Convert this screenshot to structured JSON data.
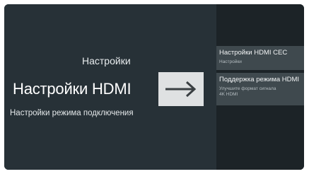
{
  "header": {
    "breadcrumb": "Настройки",
    "title": "Настройки HDMI",
    "subtitle": "Настройки режима подключения"
  },
  "icons": {
    "arrow": "arrow-right-icon"
  },
  "menu": {
    "items": [
      {
        "title": "Настройки HDMI CEC",
        "subtitle": "Настройки"
      },
      {
        "title": "Поддержка режима HDMI",
        "subtitle_line1": "Улучшите формат сигнала",
        "subtitle_line2": "4K HDMI"
      }
    ]
  },
  "colors": {
    "background": "#273137",
    "side_panel": "#1c2327",
    "focused_item": "#3f494e",
    "arrow_tile": "#dfe1e2",
    "text_primary": "#ffffff",
    "text_secondary": "#b4bcc0"
  }
}
